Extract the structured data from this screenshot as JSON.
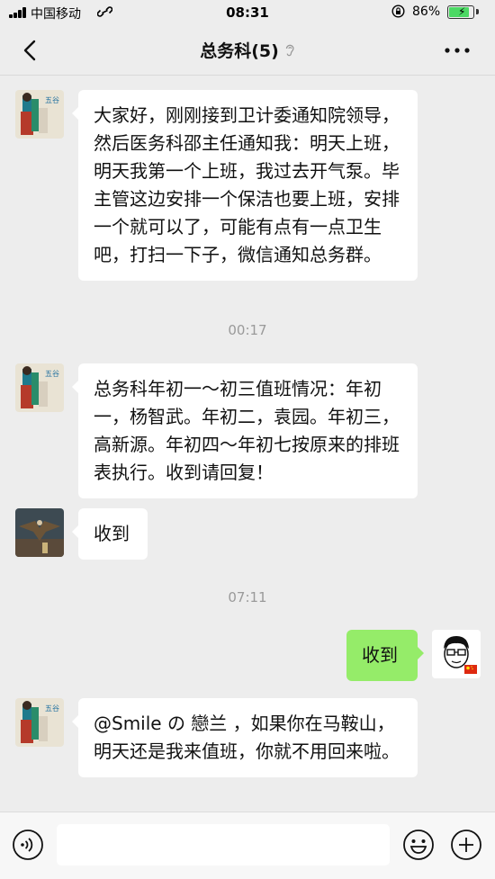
{
  "status_bar": {
    "carrier": "中国移动",
    "time": "08:31",
    "battery_percent": "86%",
    "battery_level": 0.86,
    "icons": [
      "signal-icon",
      "link-icon",
      "rotation-lock-icon",
      "battery-icon"
    ]
  },
  "nav": {
    "title": "总务科(5)",
    "icons": [
      "chevron-left-icon",
      "earpiece-icon",
      "more-icon"
    ]
  },
  "messages": [
    {
      "kind": "incoming",
      "sender": "avatar-painting",
      "text": "大家好，刚刚接到卫计委通知院领导，然后医务科邵主任通知我：明天上班，明天我第一个上班，我过去开气泵。毕主管这边安排一个保洁也要上班，安排一个就可以了，可能有点有一点卫生吧，打扫一下子，微信通知总务群。"
    },
    {
      "kind": "time",
      "text": "00:17"
    },
    {
      "kind": "incoming",
      "sender": "avatar-painting",
      "text": "总务科年初一～初三值班情况：年初一，杨智武。年初二，袁园。年初三，高新源。年初四～年初七按原来的排班表执行。收到请回复！"
    },
    {
      "kind": "incoming",
      "sender": "avatar-eagle",
      "text": "收到"
    },
    {
      "kind": "time",
      "text": "07:11"
    },
    {
      "kind": "outgoing",
      "sender": "avatar-cartoon",
      "text": "收到"
    },
    {
      "kind": "incoming",
      "sender": "avatar-painting",
      "text": "@Smile の 戀兰 ，如果你在马鞍山，明天还是我来值班，你就不用回来啦。"
    }
  ],
  "input_bar": {
    "draft": "",
    "icons": [
      "voice-icon",
      "emoji-icon",
      "plus-icon"
    ]
  },
  "colors": {
    "background": "#ededed",
    "incoming_bubble": "#ffffff",
    "outgoing_bubble": "#95ec69",
    "timestamp": "#9a9a9a",
    "battery_fill": "#4cd964",
    "flag_red": "#de2910",
    "flag_yellow": "#ffde00"
  }
}
